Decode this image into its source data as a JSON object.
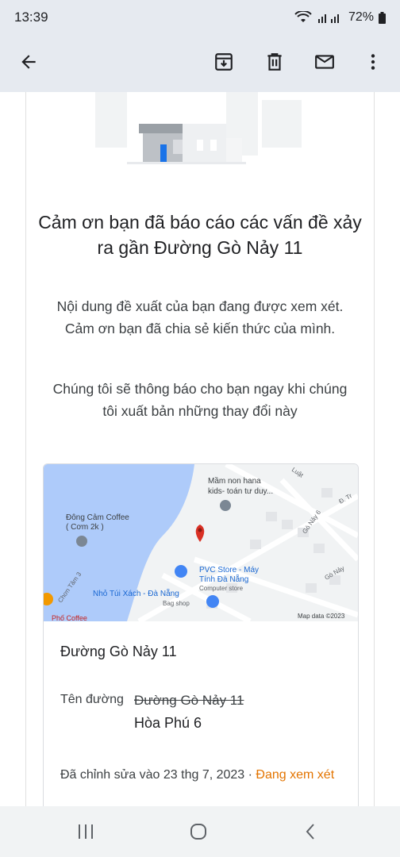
{
  "status_bar": {
    "time": "13:39",
    "battery": "72%"
  },
  "toolbar": {
    "back_icon": "arrow-left-icon",
    "archive_icon": "archive-icon",
    "delete_icon": "trash-icon",
    "mail_icon": "mail-icon",
    "more_icon": "more-vert-icon"
  },
  "message": {
    "title": "Cảm ơn bạn đã báo cáo các vấn đề xảy ra gần Đường Gò Nảy 11",
    "paragraph1": "Nội dung đề xuất của bạn đang được xem xét. Cảm ơn bạn đã chia sẻ kiến thức của mình.",
    "paragraph2": "Chúng tôi sẽ thông báo cho bạn ngay khi chúng tôi xuất bản những thay đổi này"
  },
  "map": {
    "labels": {
      "school": "Mầm non hana",
      "school_sub": "kids- toán tư duy...",
      "coffee": "Đông Cảm Coffee",
      "coffee_sub": "( Cơm 2k )",
      "store": "PVC Store - Máy",
      "store_line2": "Tính Đà Nẵng",
      "store_sub": "Computer store",
      "bag": "Nhỏ Túi Xách - Đà Nẵng",
      "bag_sub": "Bag shop",
      "road1": "Gò Nảy 6",
      "road2": "Gò Nảy",
      "road3": "Chơn Tâm 3",
      "road4": "Luật",
      "road5": "Đ. Tr",
      "cafe2": "Phố Coffee",
      "copyright": "Map data ©2023"
    }
  },
  "details": {
    "place_name": "Đường Gò Nảy 11",
    "field_label": "Tên đường",
    "old_value": "Đường Gò Nảy 11",
    "new_value": "Hòa Phú 6",
    "edited_prefix": "Đã chỉnh sửa vào 23 thg 7, 2023 · ",
    "status": "Đang xem xét"
  },
  "colors": {
    "status": "#e37400",
    "pin": "#d93025",
    "water": "#aecbfa"
  }
}
